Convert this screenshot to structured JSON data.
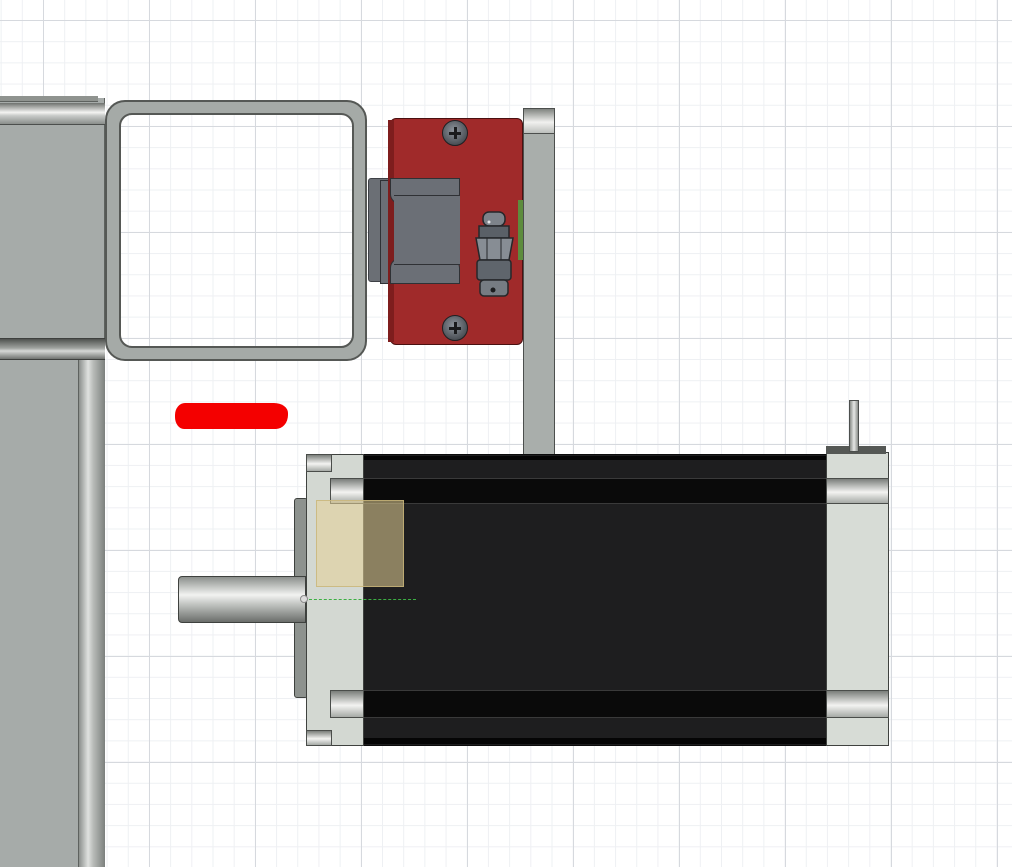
{
  "scene": {
    "type": "cad-viewport",
    "colors": {
      "carriage": "#a02a2a",
      "motor_body": "#1e1e1f",
      "aluminum": "#a9aeab",
      "highlight": "#e6d296",
      "redaction": "#f40000",
      "axis": "#3cb043"
    },
    "icons": [
      "screw-head-icon",
      "grease-nipple-icon",
      "origin-point-icon"
    ]
  }
}
